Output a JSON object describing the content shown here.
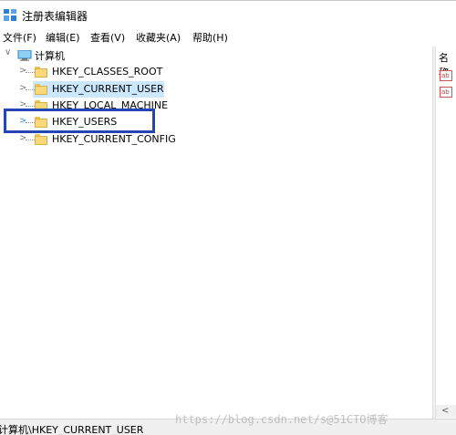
{
  "window": {
    "title": "注册表编辑器",
    "icon": "regedit-icon"
  },
  "menu": {
    "items": [
      {
        "label": "文件(F)"
      },
      {
        "label": "编辑(E)"
      },
      {
        "label": "查看(V)"
      },
      {
        "label": "收藏夹(A)"
      },
      {
        "label": "帮助(H)"
      }
    ]
  },
  "tree": {
    "root": {
      "label": "计算机",
      "icon": "computer-icon",
      "expanded": true
    },
    "nodes": [
      {
        "label": "HKEY_CLASSES_ROOT",
        "selected": false
      },
      {
        "label": "HKEY_CURRENT_USER",
        "selected": true
      },
      {
        "label": "HKEY_LOCAL_MACHINE",
        "selected": false
      },
      {
        "label": "HKEY_USERS",
        "selected": false,
        "highlighted": true
      },
      {
        "label": "HKEY_CURRENT_CONFIG",
        "selected": false
      }
    ]
  },
  "list": {
    "column_header": "名称",
    "value_icons": [
      "registry-string-icon",
      "registry-string-icon"
    ],
    "value_icon_text": "ab"
  },
  "status": {
    "path": "计算机\\HKEY_CURRENT_USER"
  },
  "watermark": "https://blog.csdn.net/s@51CTO博客",
  "colors": {
    "selection": "#cce8ff",
    "highlight_box": "#2445b3",
    "folder": "#f6d97a"
  }
}
